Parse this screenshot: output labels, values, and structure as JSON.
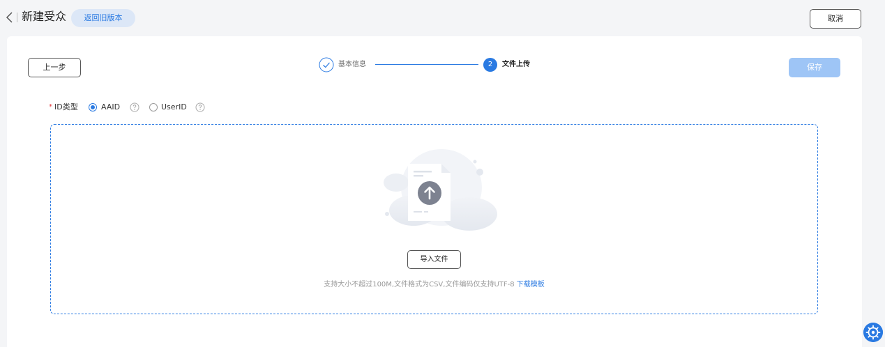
{
  "header": {
    "title": "新建受众",
    "old_version_label": "返回旧版本",
    "cancel_label": "取消"
  },
  "toolbar": {
    "prev_label": "上一步",
    "save_label": "保存"
  },
  "steps": [
    {
      "number": "1",
      "label": "基本信息",
      "status": "done"
    },
    {
      "number": "2",
      "label": "文件上传",
      "status": "active"
    }
  ],
  "form": {
    "required_mark": "*",
    "id_type_label": "ID类型",
    "options": [
      {
        "label": "AAID",
        "checked": true
      },
      {
        "label": "UserID",
        "checked": false
      }
    ]
  },
  "upload": {
    "import_label": "导入文件",
    "hint": "支持大小不超过100M,文件格式为CSV,文件编码仅支持UTF-8",
    "template_link": "下载模板"
  },
  "colors": {
    "accent": "#2a7ae2",
    "save_disabled": "#9ec5f6",
    "old_version_bg": "#dce7f7",
    "page_bg": "#f4f5f7"
  },
  "icons": {
    "back": "chevron-left-icon",
    "step_done": "check-circle-icon",
    "help": "question-circle-icon",
    "upload": "upload-arrow-icon",
    "float": "gear-icon"
  }
}
